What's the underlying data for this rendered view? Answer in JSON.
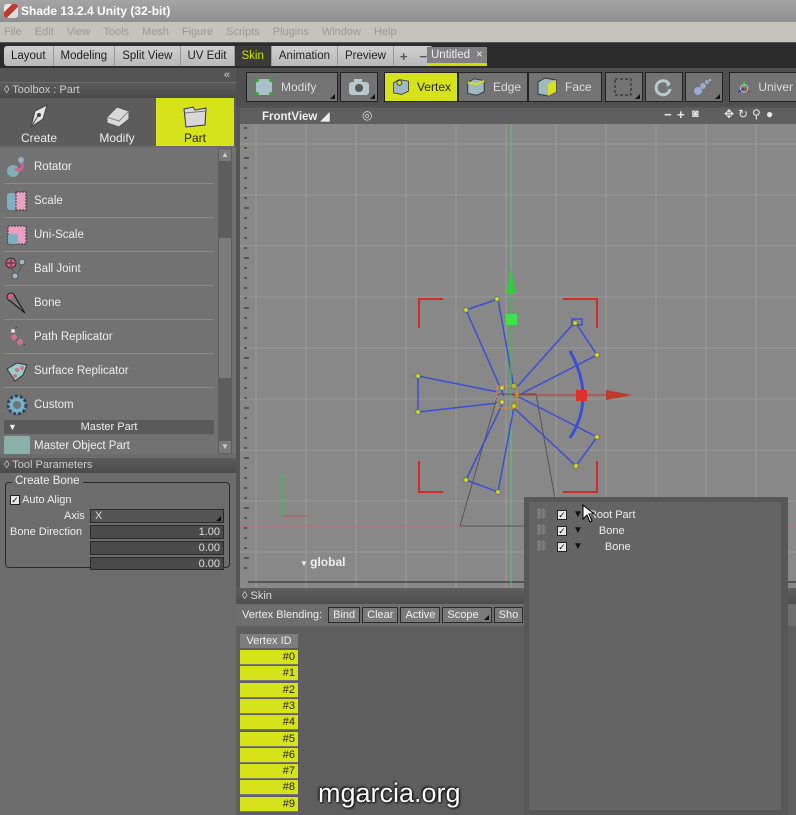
{
  "window": {
    "title": "Shade 13.2.4 Unity (32-bit)"
  },
  "menu": [
    "File",
    "Edit",
    "View",
    "Tools",
    "Mesh",
    "Figure",
    "Scripts",
    "Plugins",
    "Window",
    "Help"
  ],
  "workspace_tabs": {
    "items": [
      "Layout",
      "Modeling",
      "Split View",
      "UV Edit",
      "Skin",
      "Animation",
      "Preview"
    ],
    "active": "Skin",
    "add_label": "+",
    "remove_label": "−"
  },
  "document_tab": {
    "label": "Untitled",
    "close": "×"
  },
  "toolbox": {
    "collapse_label": "«",
    "title": "Toolbox : Part",
    "modes": [
      {
        "label": "Create",
        "icon": "pen-nib-icon"
      },
      {
        "label": "Modify",
        "icon": "eraser-block-icon"
      },
      {
        "label": "Part",
        "icon": "folder-icon",
        "active": true
      }
    ],
    "tools": [
      {
        "label": "Rotator",
        "icon": "rotator-icon"
      },
      {
        "label": "Scale",
        "icon": "scale-icon"
      },
      {
        "label": "Uni-Scale",
        "icon": "uni-scale-icon"
      },
      {
        "label": "Ball Joint",
        "icon": "ball-joint-icon"
      },
      {
        "label": "Bone",
        "icon": "bone-icon"
      },
      {
        "label": "Path Replicator",
        "icon": "path-replicator-icon"
      },
      {
        "label": "Surface Replicator",
        "icon": "surface-replicator-icon"
      },
      {
        "label": "Custom",
        "icon": "gear-icon"
      }
    ],
    "section_label": "Master Part",
    "cut_off_item": "Master Object Part"
  },
  "tool_parameters": {
    "title": "Tool Parameters",
    "group_title": "Create Bone",
    "auto_align_label": "Auto Align",
    "auto_align_checked": true,
    "axis_label": "Axis",
    "axis_value": "X",
    "bone_direction_label": "Bone Direction",
    "bone_direction": [
      "1.00",
      "0.00",
      "0.00"
    ]
  },
  "view_toolbar": {
    "modify_label": "Modify",
    "vertex_label": "Vertex",
    "edge_label": "Edge",
    "face_label": "Face",
    "universal_label": "Univer",
    "active": "Vertex"
  },
  "viewport": {
    "title": "FrontView",
    "coord_label": "global",
    "axis_y_label": "Y"
  },
  "skin": {
    "title": "Skin",
    "vertex_blending_label": "Vertex Blending:",
    "buttons": [
      "Bind",
      "Clear",
      "Active",
      "Scope",
      "Sho"
    ],
    "column_header": "Vertex ID",
    "vertex_ids": [
      "#0",
      "#1",
      "#2",
      "#3",
      "#4",
      "#5",
      "#6",
      "#7",
      "#8",
      "#9"
    ]
  },
  "outliner": {
    "rows": [
      {
        "label": "Root Part",
        "checked": true
      },
      {
        "label": "Bone",
        "checked": true
      },
      {
        "label": "Bone",
        "checked": true
      }
    ]
  },
  "watermark": "mgarcia.org",
  "colors": {
    "accent": "#d6e21a",
    "bone_lines": "#3a4fd6",
    "x_axis": "#d9312a",
    "y_axis": "#2ecc40"
  }
}
